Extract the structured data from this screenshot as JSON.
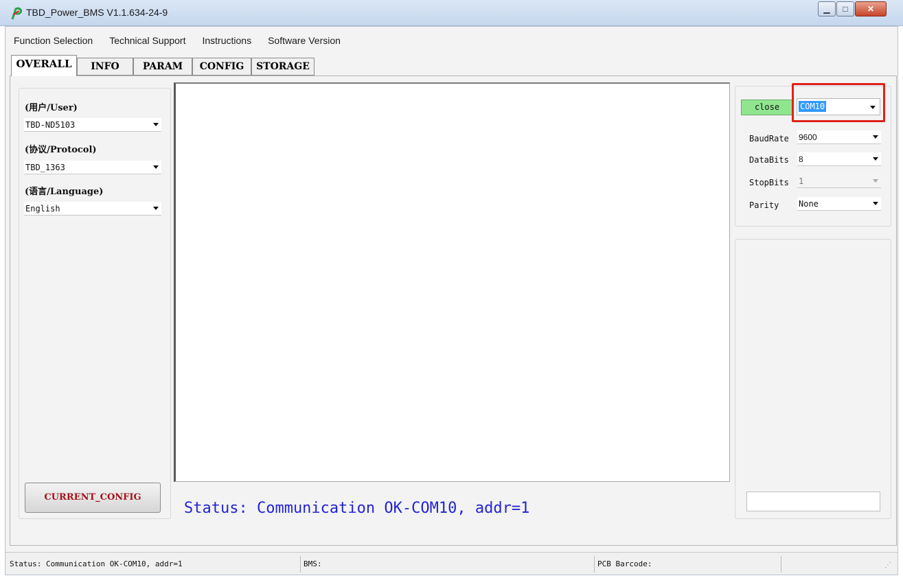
{
  "window": {
    "title": "TBD_Power_BMS V1.1.634-24-9",
    "minimize_symbol": "▁",
    "maximize_symbol": "□",
    "close_symbol": "✕",
    "logo_icon": "green-red-p-logo"
  },
  "menu": {
    "items": [
      "Function Selection",
      "Technical Support",
      "Instructions",
      "Software Version"
    ]
  },
  "tabs": [
    "OVERALL",
    "INFO",
    "PARAM",
    "CONFIG",
    "STORAGE"
  ],
  "active_tab": "OVERALL",
  "left_panel": {
    "user_label": "(用户/User)",
    "user_value": "TBD-ND5103",
    "protocol_label": "(协议/Protocol)",
    "protocol_value": "TBD_1363",
    "language_label": "(语言/Language)",
    "language_value": "English",
    "current_config_button": "CURRENT_CONFIG"
  },
  "main": {
    "status_message": "Status: Communication OK-COM10, addr=1"
  },
  "serial": {
    "close_button": "close",
    "port": "COM10",
    "baudrate_label": "BaudRate",
    "baudrate_value": "9600",
    "databits_label": "DataBits",
    "databits_value": "8",
    "stopbits_label": "StopBits",
    "stopbits_value": "1",
    "parity_label": "Parity",
    "parity_value": "None"
  },
  "statusbar": {
    "status": "Status: Communication OK-COM10, addr=1",
    "bms": "BMS:",
    "pcb_barcode": "PCB Barcode:"
  },
  "colors": {
    "accent_status_text": "#2323d6",
    "close_button_bg": "#8fe68f",
    "highlight_border": "#e0201a",
    "config_button_text": "#a3121a"
  }
}
